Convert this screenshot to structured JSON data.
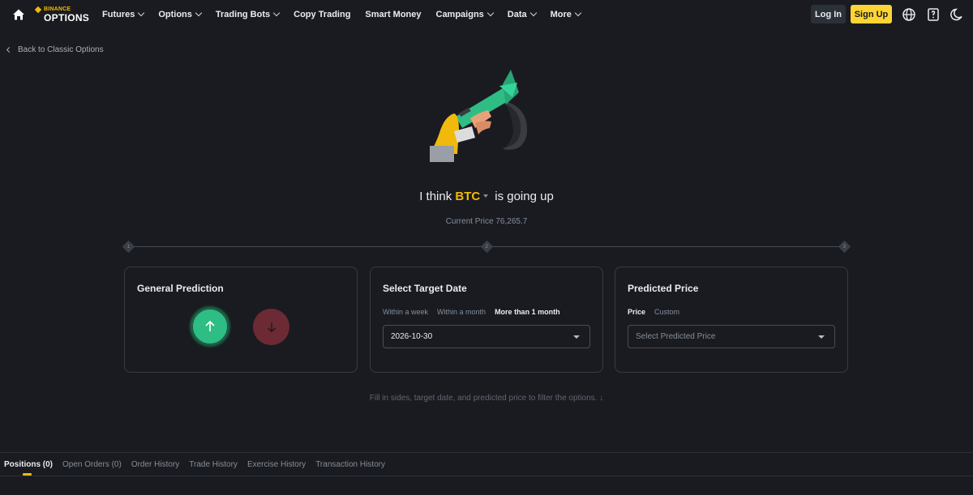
{
  "brand": {
    "line1": "BINANCE",
    "line2": "OPTIONS"
  },
  "nav": {
    "items": [
      {
        "label": "Futures",
        "dropdown": true
      },
      {
        "label": "Options",
        "dropdown": true
      },
      {
        "label": "Trading Bots",
        "dropdown": true
      },
      {
        "label": "Copy Trading",
        "dropdown": false
      },
      {
        "label": "Smart Money",
        "dropdown": false
      },
      {
        "label": "Campaigns",
        "dropdown": true
      },
      {
        "label": "Data",
        "dropdown": true
      },
      {
        "label": "More",
        "dropdown": true
      }
    ],
    "login": "Log In",
    "signup": "Sign Up",
    "icons": [
      "globe-icon",
      "download-icon",
      "moon-icon"
    ]
  },
  "back_link": "Back to Classic Options",
  "headline": {
    "prefix": "I think",
    "coin": "BTC",
    "suffix": "is going up"
  },
  "current_price": "Current Price 76,265.7",
  "steps": [
    "1",
    "2",
    "3"
  ],
  "cards": {
    "prediction": {
      "title": "General Prediction"
    },
    "target_date": {
      "title": "Select Target Date",
      "tabs": [
        "Within a week",
        "Within a month",
        "More than 1 month"
      ],
      "active_tab": 2,
      "value": "2026-10-30"
    },
    "predicted_price": {
      "title": "Predicted Price",
      "tabs": [
        "Price",
        "Custom"
      ],
      "active_tab": 0,
      "placeholder": "Select Predicted Price"
    }
  },
  "hint": "Fill in sides, target date, and predicted price to filter the options. ↓",
  "bottom_tabs": [
    "Positions (0)",
    "Open Orders (0)",
    "Order History",
    "Trade History",
    "Exercise History",
    "Transaction History"
  ],
  "colors": {
    "accent": "#f0b90b",
    "up": "#2ebd85",
    "down": "#6b2a34",
    "bg": "#1a1b20"
  }
}
